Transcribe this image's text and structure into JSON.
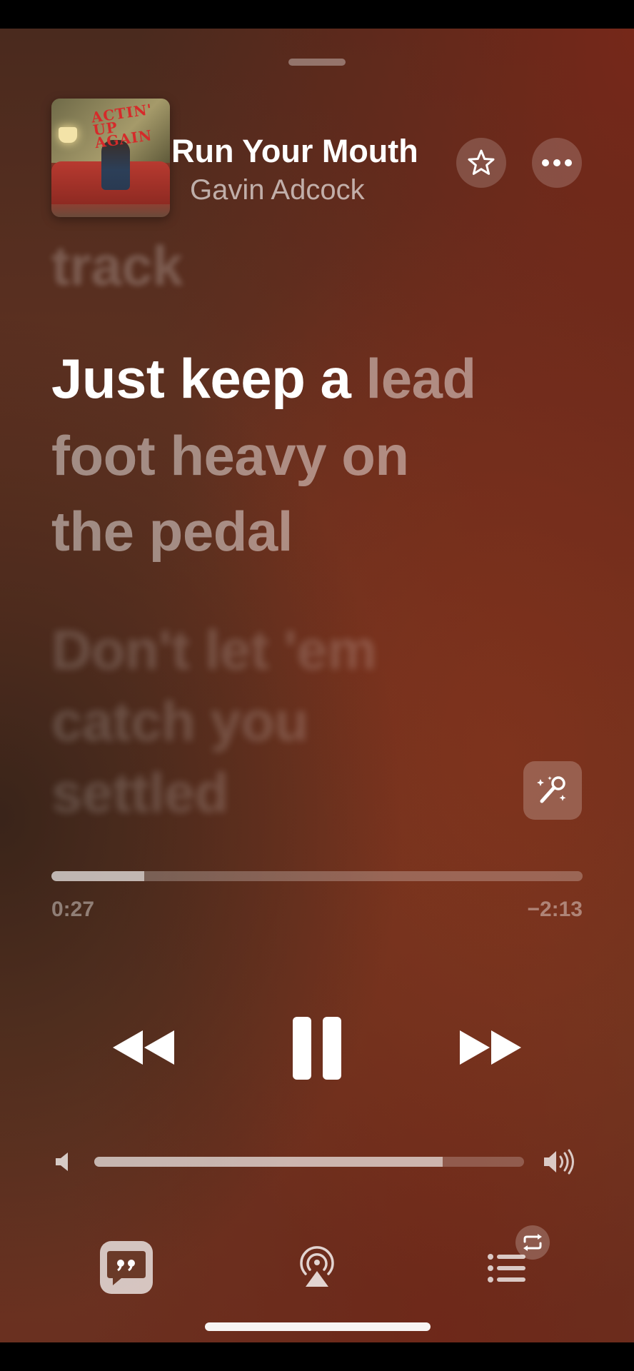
{
  "player": {
    "song_title": "Run Your Mouth",
    "artist": "Gavin Adcock",
    "artwork_text": "ACTIN' UP AGAIN",
    "artwork_icon": "album-artwork"
  },
  "header_actions": {
    "favorite_icon": "star-icon",
    "more_icon": "ellipsis-icon"
  },
  "lyrics": {
    "previous_line": "track",
    "active_sung": "Just keep a",
    "active_unsung": " lead",
    "active_line_2": "foot heavy on",
    "active_line_3": "the pedal",
    "next_line_1": "Don't let 'em",
    "next_line_2": "catch you",
    "next_line_3": "settled",
    "sing_icon": "microphone-sparkles-icon"
  },
  "playback": {
    "elapsed": "0:27",
    "remaining": "−2:13",
    "progress_fraction": 0.175,
    "rewind_icon": "rewind-icon",
    "pause_icon": "pause-icon",
    "forward_icon": "fast-forward-icon"
  },
  "volume": {
    "level_fraction": 0.81,
    "low_icon": "speaker-low-icon",
    "high_icon": "speaker-high-icon"
  },
  "bottom_bar": {
    "lyrics_icon": "quote-bubble-icon",
    "airplay_icon": "airplay-icon",
    "queue_icon": "queue-list-icon",
    "repeat_icon": "repeat-icon"
  },
  "colors": {
    "background_top": "#4a2a1e",
    "background_mid": "#6a3522",
    "accent_red": "#a8382c",
    "text_primary": "#ffffff"
  }
}
